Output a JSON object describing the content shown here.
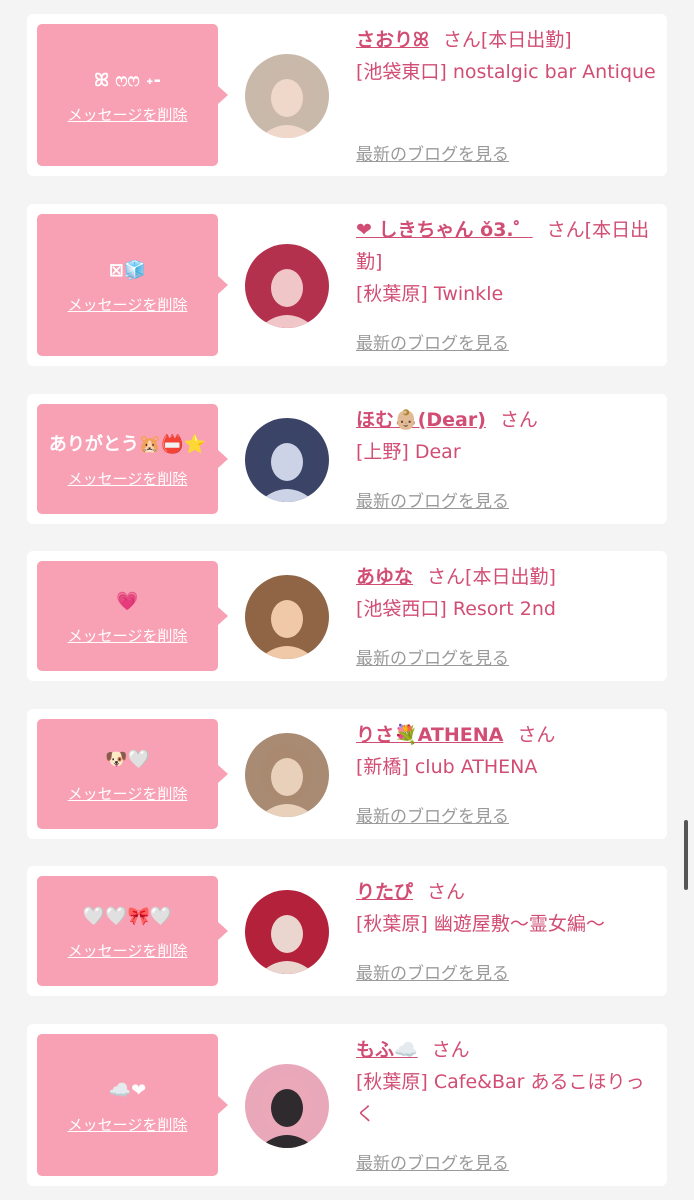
{
  "delete_label": "メッセージを削除",
  "blog_label": "最新のブログを見る",
  "san_suffix": "さん",
  "accent_color": "#d24d74",
  "bubble_color": "#f8a0b4",
  "entries": [
    {
      "message": "ꕤ ෆෆ ˖-",
      "name": "さおりꕤ",
      "status": "[本日出勤]",
      "shop": "[池袋東口] nostalgic bar Antique",
      "avatar_colors": [
        "#c9b9aa",
        "#efd8c9"
      ]
    },
    {
      "message": "⊠🧊",
      "name": "❤︎ しきちゃん ǒ3.゜",
      "status": "[本日出勤]",
      "shop": "[秋葉原] Twinkle",
      "avatar_colors": [
        "#b3314d",
        "#f1c6c8"
      ]
    },
    {
      "message": "ありがとう🐹📛⭐",
      "name": "ほむ👶🏼(Dear)",
      "status": "",
      "shop": "[上野] Dear",
      "avatar_colors": [
        "#3b4467",
        "#cdd3e6"
      ]
    },
    {
      "message": "💗",
      "name": "あゆな",
      "status": "[本日出勤]",
      "shop": "[池袋西口] Resort 2nd",
      "avatar_colors": [
        "#8f6546",
        "#f0c9a8"
      ]
    },
    {
      "message": "🐶🤍",
      "name": "りさ💐ATHENA",
      "status": "",
      "shop": "[新橋] club ATHENA",
      "avatar_colors": [
        "#a98a72",
        "#e8d0bb"
      ]
    },
    {
      "message": "🤍🤍🎀🤍",
      "name": "りたぴ",
      "status": "",
      "shop": "[秋葉原] 幽遊屋敷〜霊女編〜",
      "avatar_colors": [
        "#b3213b",
        "#ebd5cf"
      ]
    },
    {
      "message": "☁️❤︎",
      "name": "もふ☁️",
      "status": "",
      "shop": "[秋葉原] Cafe&Bar あるこほりっく",
      "avatar_colors": [
        "#e9a8b9",
        "#2f2a2e"
      ]
    }
  ]
}
